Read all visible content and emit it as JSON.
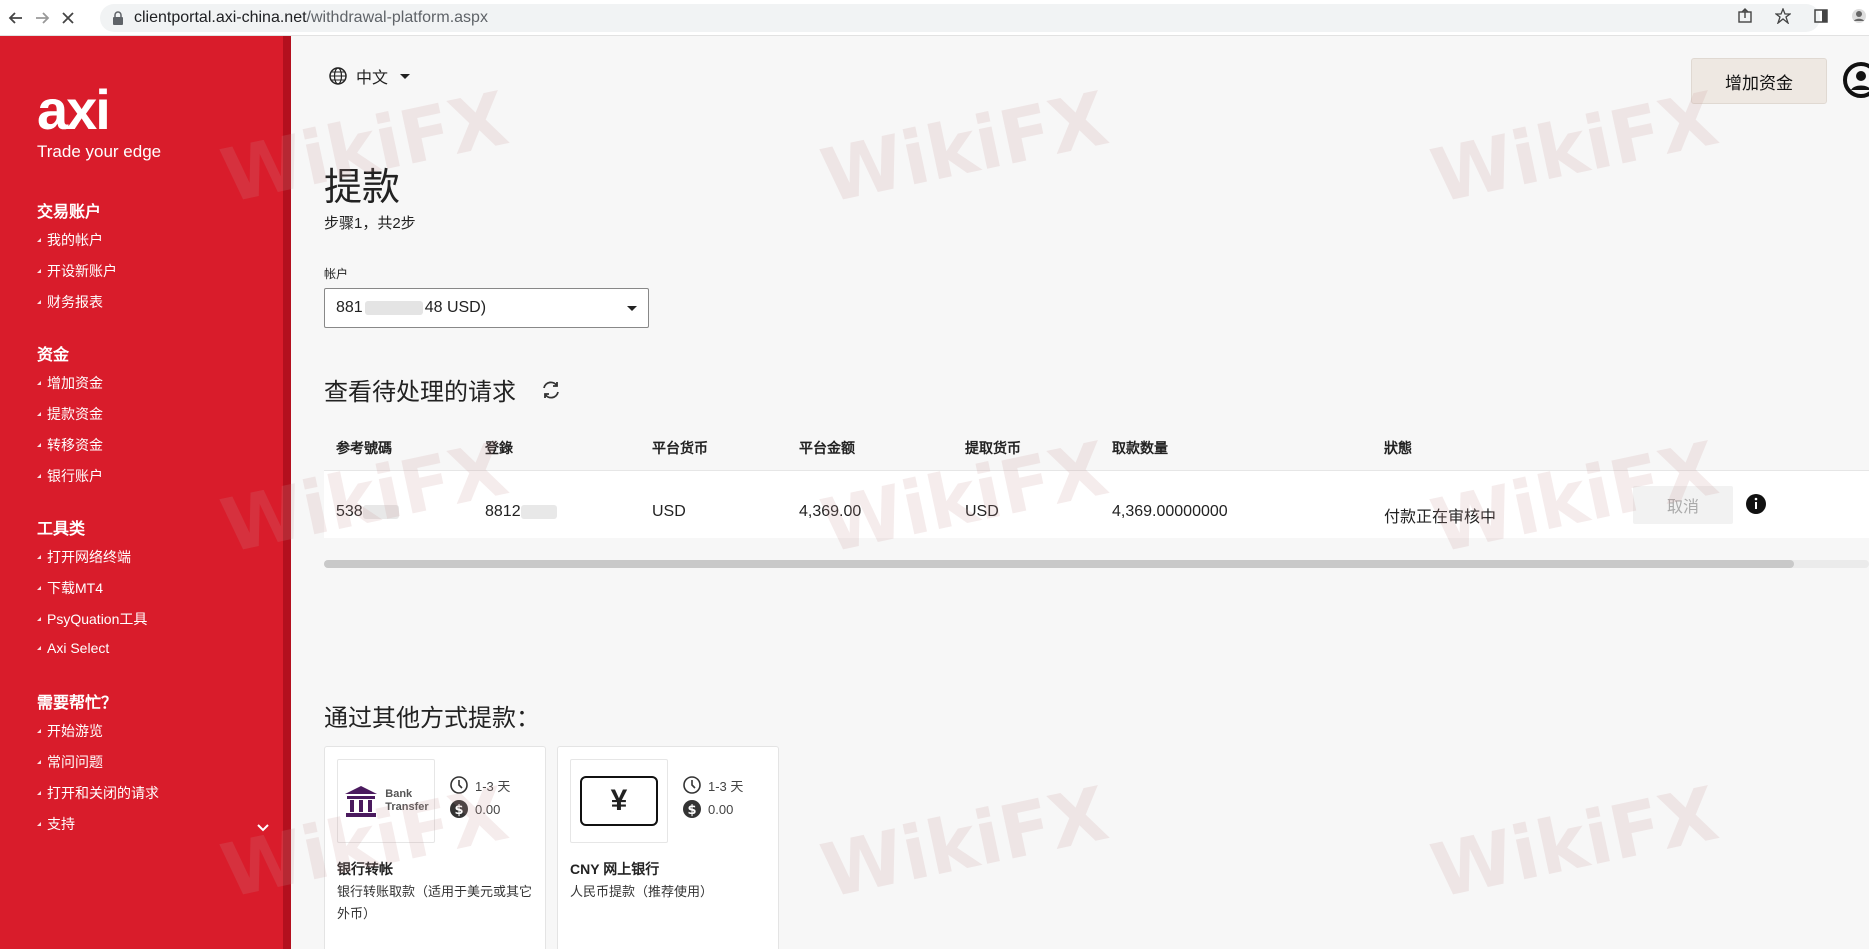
{
  "browser": {
    "url_host": "clientportal.axi-china.net",
    "url_path": "/withdrawal-platform.aspx"
  },
  "sidebar": {
    "logo": "axi",
    "tagline": "Trade your edge",
    "sections": [
      {
        "title": "交易账户",
        "items": [
          "我的帐户",
          "开设新账户",
          "财务报表"
        ]
      },
      {
        "title": "资金",
        "items": [
          "增加资金",
          "提款资金",
          "转移资金",
          "银行账户"
        ]
      },
      {
        "title": "工具类",
        "items": [
          "打开网络终端",
          "下载MT4",
          "PsyQuation工具",
          "Axi Select"
        ]
      },
      {
        "title": "需要帮忙？",
        "items": [
          "开始游览",
          "常问问题",
          "打开和关闭的请求",
          "支持"
        ]
      }
    ]
  },
  "header": {
    "language": "中文",
    "add_funds": "增加资金"
  },
  "page": {
    "title": "提款",
    "steps": "步骤1，共2步",
    "account_label": "帐户",
    "account_value_prefix": "881",
    "account_value_suffix": "48 USD)"
  },
  "pending": {
    "title": "查看待处理的请求",
    "columns": [
      "参考號碼",
      "登錄",
      "平台货币",
      "平台金额",
      "提取货币",
      "取款数量",
      "狀態"
    ],
    "row": {
      "ref": "538",
      "login": "8812",
      "platform_currency": "USD",
      "platform_amount": "4,369.00",
      "withdraw_currency": "USD",
      "withdraw_amount": "4,369.00000000",
      "status": "付款正在审核中",
      "cancel": "取消"
    }
  },
  "other_methods": {
    "title": "通过其他方式提款：",
    "cards": [
      {
        "logo_text_1": "Bank",
        "logo_text_2": "Transfer",
        "time": "1-3 天",
        "fee": "0.00",
        "name": "银行转帐",
        "desc": "银行转账取款（适用于美元或其它外币）"
      },
      {
        "logo_symbol": "¥",
        "time": "1-3 天",
        "fee": "0.00",
        "name": "CNY 网上银行",
        "desc": "人民币提款（推荐使用）"
      }
    ]
  },
  "watermark": "WikiFX",
  "colors": {
    "sidebar": "#d91c2b",
    "accent_button": "#eee8e2"
  }
}
